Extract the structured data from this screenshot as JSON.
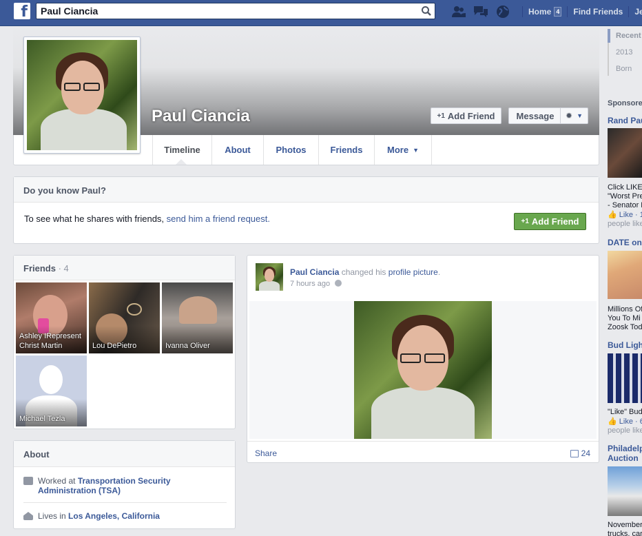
{
  "header": {
    "search_value": "Paul Ciancia",
    "nav": [
      {
        "label": "Home",
        "count": "4"
      },
      {
        "label": "Find Friends"
      },
      {
        "label": "Jeffe"
      }
    ]
  },
  "profile": {
    "name": "Paul Ciancia",
    "add_friend_label": "Add Friend",
    "message_label": "Message",
    "tabs": [
      "Timeline",
      "About",
      "Photos",
      "Friends",
      "More"
    ]
  },
  "know": {
    "title": "Do you know Paul?",
    "text": "To see what he shares with friends, ",
    "link": "send him a friend request.",
    "button": "Add Friend"
  },
  "friends": {
    "title": "Friends",
    "count": "· 4",
    "items": [
      {
        "name": "Ashley IRepresent Christ Martin"
      },
      {
        "name": "Lou DePietro"
      },
      {
        "name": "Ivanna Oliver"
      },
      {
        "name": "Michael Tezla"
      }
    ]
  },
  "about": {
    "title": "About",
    "work_prefix": "Worked at ",
    "work": "Transportation Security Administration (TSA)",
    "lives_prefix": "Lives in ",
    "lives": "Los Angeles, California"
  },
  "post": {
    "author": "Paul Ciancia",
    "action": " changed his ",
    "object": "profile picture",
    "period": ".",
    "time": "7 hours ago",
    "share": "Share",
    "comments": "24"
  },
  "rail": {
    "scrubber": [
      "Recent",
      "2013",
      "Born"
    ],
    "sponsored": "Sponsore",
    "ads": [
      {
        "title": "Rand Pau",
        "text": [
          "Click LIKE i",
          "\"Worst Pre",
          "- Senator R"
        ],
        "like": "Like · 1",
        "meta": "people like"
      },
      {
        "title": "DATE on",
        "text": [
          "Millions Of",
          "You To Mi",
          "Zoosk Toda"
        ]
      },
      {
        "title": "Bud Light",
        "text": [
          "\"Like\" Bud"
        ],
        "like": "Like · 6",
        "meta": "people like"
      },
      {
        "title": "Philadelp",
        "title2": "Auction",
        "text": [
          "November",
          "trucks, car"
        ]
      }
    ]
  },
  "colors": {
    "brand": "#3b5998",
    "green": "#69a74e"
  }
}
